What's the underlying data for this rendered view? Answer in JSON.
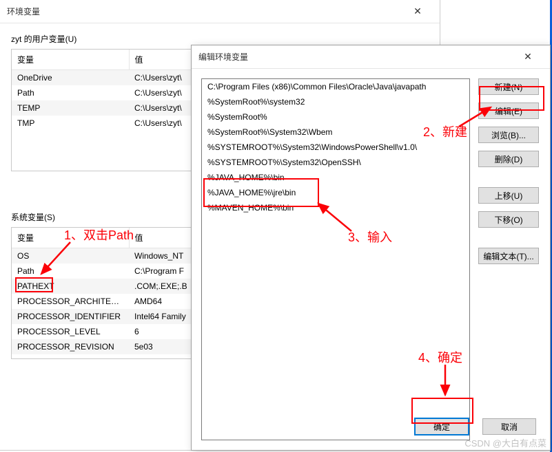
{
  "parentWindow": {
    "title": "环境变量",
    "userVarsLabel": "zyt 的用户变量(U)",
    "systemVarsLabel": "系统变量(S)",
    "headers": {
      "name": "变量",
      "value": "值"
    },
    "userVars": [
      {
        "name": "OneDrive",
        "value": "C:\\Users\\zyt\\"
      },
      {
        "name": "Path",
        "value": "C:\\Users\\zyt\\"
      },
      {
        "name": "TEMP",
        "value": "C:\\Users\\zyt\\"
      },
      {
        "name": "TMP",
        "value": "C:\\Users\\zyt\\"
      }
    ],
    "systemVars": [
      {
        "name": "OS",
        "value": "Windows_NT"
      },
      {
        "name": "Path",
        "value": "C:\\Program F"
      },
      {
        "name": "PATHEXT",
        "value": ".COM;.EXE;.B"
      },
      {
        "name": "PROCESSOR_ARCHITECT...",
        "value": "AMD64"
      },
      {
        "name": "PROCESSOR_IDENTIFIER",
        "value": "Intel64 Family"
      },
      {
        "name": "PROCESSOR_LEVEL",
        "value": "6"
      },
      {
        "name": "PROCESSOR_REVISION",
        "value": "5e03"
      }
    ]
  },
  "editDialog": {
    "title": "编辑环境变量",
    "entries": [
      "C:\\Program Files (x86)\\Common Files\\Oracle\\Java\\javapath",
      "%SystemRoot%\\system32",
      "%SystemRoot%",
      "%SystemRoot%\\System32\\Wbem",
      "%SYSTEMROOT%\\System32\\WindowsPowerShell\\v1.0\\",
      "%SYSTEMROOT%\\System32\\OpenSSH\\",
      "%JAVA_HOME%\\bin",
      "%JAVA_HOME%\\jre\\bin",
      "%MAVEN_HOME%\\bin"
    ],
    "buttons": {
      "new": "新建(N)",
      "edit": "编辑(E)",
      "browse": "浏览(B)...",
      "delete": "删除(D)",
      "moveUp": "上移(U)",
      "moveDown": "下移(O)",
      "editText": "编辑文本(T)...",
      "ok": "确定",
      "cancel": "取消"
    }
  },
  "annotations": {
    "a1": "1、双击Path",
    "a2": "2、新建",
    "a3": "3、输入",
    "a4": "4、确定",
    "watermark": "CSDN @大白有点菜"
  }
}
